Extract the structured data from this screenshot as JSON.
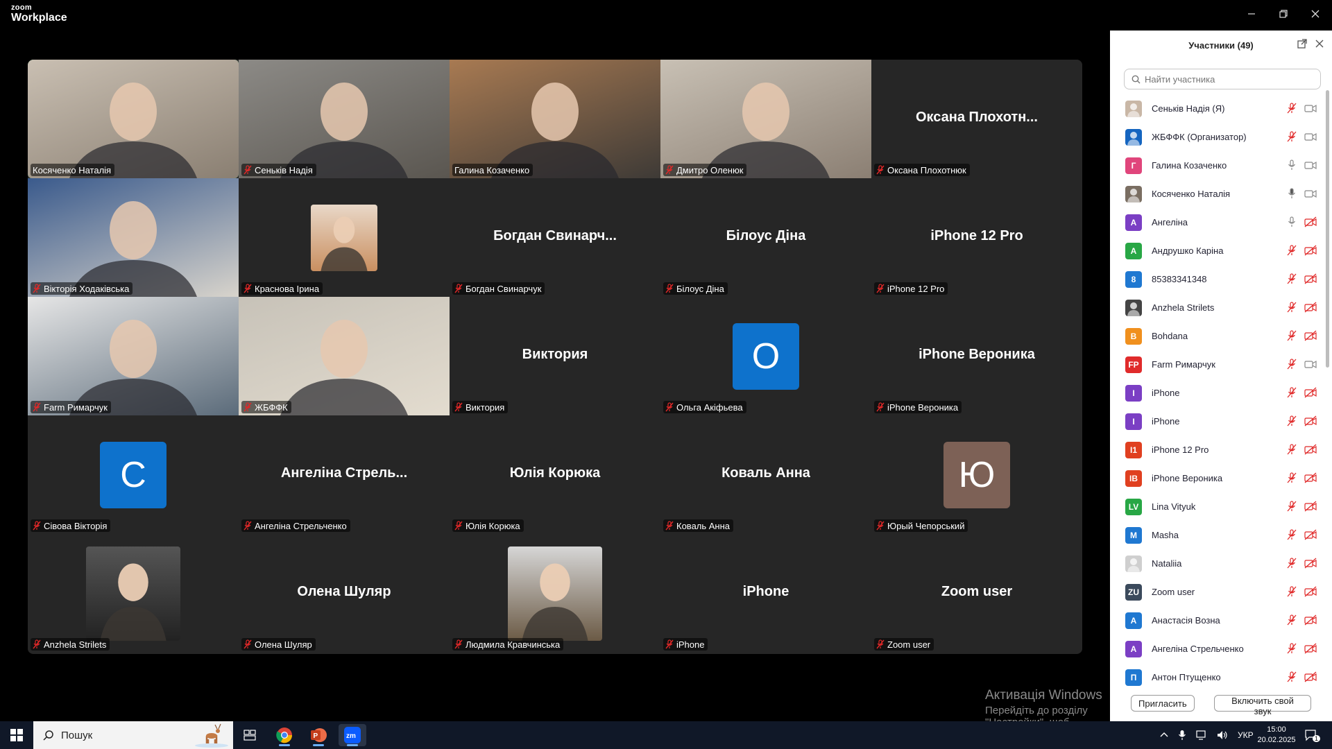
{
  "app": {
    "brand_small": "zoom",
    "brand_large": "Workplace"
  },
  "tiles": [
    {
      "name": "Косяченко Наталія",
      "kind": "video",
      "active": true,
      "mic_muted": false,
      "colors": [
        "#c9bfb2",
        "#8a7f72"
      ]
    },
    {
      "name": "Сеньків Надія",
      "kind": "video",
      "mic_muted": true,
      "colors": [
        "#8c8a86",
        "#5a5650"
      ]
    },
    {
      "name": "Галина Козаченко",
      "kind": "video",
      "mic_muted": false,
      "colors": [
        "#a87a52",
        "#3e3a36"
      ]
    },
    {
      "name": "Дмитро Оленюк",
      "kind": "video",
      "mic_muted": true,
      "colors": [
        "#c8c0b4",
        "#8b7f73"
      ]
    },
    {
      "name": "Оксана Плохотнюк",
      "kind": "name",
      "big_label": "Оксана  Плохотн...",
      "mic_muted": true
    },
    {
      "name": "Вікторія Ходаківська",
      "kind": "video",
      "mic_muted": true,
      "colors": [
        "#3a5a8c",
        "#d8d4cc"
      ]
    },
    {
      "name": "Краснова Ірина",
      "kind": "photo",
      "mic_muted": true,
      "colors": [
        "#e9d8c8",
        "#c98f60"
      ]
    },
    {
      "name": "Богдан Свинарчук",
      "kind": "name",
      "big_label": "Богдан  Свинарч...",
      "mic_muted": true
    },
    {
      "name": "Білоус Діна",
      "kind": "name",
      "big_label": "Білоус Діна",
      "mic_muted": true
    },
    {
      "name": "iPhone 12 Pro",
      "kind": "name",
      "big_label": "iPhone 12 Pro",
      "mic_muted": true
    },
    {
      "name": "Farm Римарчук",
      "kind": "video",
      "mic_muted": true,
      "colors": [
        "#e6e6e6",
        "#5b6b7a"
      ]
    },
    {
      "name": "ЖБФФК",
      "kind": "video",
      "mic_muted": true,
      "colors": [
        "#c7c2b8",
        "#e3dccf"
      ]
    },
    {
      "name": "Виктория",
      "kind": "name",
      "big_label": "Виктория",
      "mic_muted": true
    },
    {
      "name": "Ольга Акіфьева",
      "kind": "letter",
      "letter": "О",
      "letter_color": "#0e72cc",
      "mic_muted": true
    },
    {
      "name": "iPhone Вероника",
      "kind": "name",
      "big_label": "iPhone Вероника",
      "mic_muted": true
    },
    {
      "name": "Сівова Вікторія",
      "kind": "letter",
      "letter": "С",
      "letter_color": "#0e72cc",
      "mic_muted": true
    },
    {
      "name": "Ангеліна Стрельченко",
      "kind": "name",
      "big_label": "Ангеліна Стрель...",
      "mic_muted": true
    },
    {
      "name": "Юлія Корюка",
      "kind": "name",
      "big_label": "Юлія Корюка",
      "mic_muted": true
    },
    {
      "name": "Коваль Анна",
      "kind": "name",
      "big_label": "Коваль Анна",
      "mic_muted": true
    },
    {
      "name": "Юрый Чепорський",
      "kind": "letter",
      "letter": "Ю",
      "letter_color": "#7d6156",
      "mic_muted": true
    },
    {
      "name": "Anzhela Strilets",
      "kind": "photo",
      "mic_muted": true,
      "colors": [
        "#555",
        "#222"
      ]
    },
    {
      "name": "Олена Шуляр",
      "kind": "name",
      "big_label": "Олена Шуляр",
      "mic_muted": true
    },
    {
      "name": "Людмила Кравчинська",
      "kind": "photo",
      "mic_muted": true,
      "colors": [
        "#d6d6d6",
        "#6b5a45"
      ]
    },
    {
      "name": "iPhone",
      "kind": "name",
      "big_label": "iPhone",
      "mic_muted": true
    },
    {
      "name": "Zoom user",
      "kind": "name",
      "big_label": "Zoom user",
      "mic_muted": true
    }
  ],
  "watermark": {
    "line1": "Активація Windows",
    "line2": "Перейдіть до розділу \"Настройки\", щоб активувати Windows."
  },
  "panel": {
    "title": "Участники (49)",
    "search_placeholder": "Найти участника",
    "invite_label": "Пригласить",
    "unmute_label": "Включить свой звук",
    "participants": [
      {
        "name": "Сеньків Надія (Я)",
        "avatar": "",
        "color": "#c9b7a6",
        "photo": true,
        "mic": "muted",
        "cam": "on"
      },
      {
        "name": "ЖБФФК (Организатор)",
        "avatar": "",
        "color": "#1565c0",
        "photo": true,
        "mic": "muted",
        "cam": "on"
      },
      {
        "name": "Галина Козаченко",
        "avatar": "Г",
        "color": "#e0457b",
        "mic": "on",
        "cam": "on"
      },
      {
        "name": "Косяченко Наталія",
        "avatar": "",
        "color": "#7a6e62",
        "photo": true,
        "mic": "active",
        "cam": "on"
      },
      {
        "name": "Ангеліна",
        "avatar": "А",
        "color": "#7b3fc4",
        "mic": "on",
        "cam": "off"
      },
      {
        "name": "Андрушко Каріна",
        "avatar": "А",
        "color": "#28a745",
        "mic": "muted",
        "cam": "off"
      },
      {
        "name": "85383341348",
        "avatar": "8",
        "color": "#1f78d1",
        "mic": "muted",
        "cam": "off"
      },
      {
        "name": "Anzhela Strilets",
        "avatar": "",
        "color": "#444",
        "photo": true,
        "mic": "muted",
        "cam": "off"
      },
      {
        "name": "Bohdana",
        "avatar": "B",
        "color": "#f0901e",
        "mic": "muted",
        "cam": "off"
      },
      {
        "name": "Farm Римарчук",
        "avatar": "FP",
        "color": "#e02b2b",
        "mic": "muted",
        "cam": "on"
      },
      {
        "name": "iPhone",
        "avatar": "I",
        "color": "#7b3fc4",
        "mic": "muted",
        "cam": "off"
      },
      {
        "name": "iPhone",
        "avatar": "I",
        "color": "#7b3fc4",
        "mic": "muted",
        "cam": "off"
      },
      {
        "name": "iPhone 12 Pro",
        "avatar": "I1",
        "color": "#e04020",
        "mic": "muted",
        "cam": "off"
      },
      {
        "name": "iPhone Вероника",
        "avatar": "IB",
        "color": "#e04020",
        "mic": "muted",
        "cam": "off"
      },
      {
        "name": "Lina Vityuk",
        "avatar": "LV",
        "color": "#28a745",
        "mic": "muted",
        "cam": "off"
      },
      {
        "name": "Masha",
        "avatar": "M",
        "color": "#1f78d1",
        "mic": "muted",
        "cam": "off"
      },
      {
        "name": "Nataliia",
        "avatar": "",
        "color": "#cfcfcf",
        "photo": true,
        "mic": "muted",
        "cam": "off"
      },
      {
        "name": "Zoom user",
        "avatar": "ZU",
        "color": "#3b4a5c",
        "mic": "muted",
        "cam": "off"
      },
      {
        "name": "Анастасія Возна",
        "avatar": "А",
        "color": "#1f78d1",
        "mic": "muted",
        "cam": "off"
      },
      {
        "name": "Ангеліна Стрельченко",
        "avatar": "А",
        "color": "#7b3fc4",
        "mic": "muted",
        "cam": "off"
      },
      {
        "name": "Антон Птущенко",
        "avatar": "П",
        "color": "#1f78d1",
        "mic": "muted",
        "cam": "off"
      }
    ]
  },
  "taskbar": {
    "search_label": "Пошук",
    "lang": "УКР",
    "time": "15:00",
    "date": "20.02.2025",
    "notif_count": "1"
  }
}
